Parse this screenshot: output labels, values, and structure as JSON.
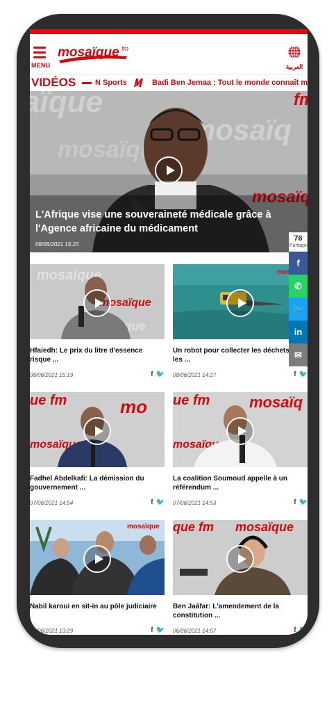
{
  "header": {
    "menu_label": "MENU",
    "logo_text": "mosaïque",
    "logo_suffix": "fm",
    "lang_label": "العربية"
  },
  "ticker": {
    "section_title": "VIDÉOS",
    "item1": "N Sports",
    "item2": "Badi Ben Jemaa : Tout le monde connaît mon cl"
  },
  "hero": {
    "title": "L'Afrique vise une souveraineté médicale grâce à l'Agence africaine du médicament",
    "date": "08/06/2021 15:20"
  },
  "videos": [
    {
      "title": "Hfaiedh: Le prix du litre d'essence risque ...",
      "date": "08/06/2021 15:19"
    },
    {
      "title": "Un robot pour collecter les déchets dans les ...",
      "date": "08/06/2021 14:27"
    },
    {
      "title": "Fadhel Abdelkafi: La démission du gouvernement ...",
      "date": "07/06/2021 14:54"
    },
    {
      "title": "La coalition Soumoud appelle à un référendum ...",
      "date": "07/06/2021 14:53"
    },
    {
      "title": "Nabil karoui en sit-in au pôle judiciaire",
      "date": "07/06/2021 13:29"
    },
    {
      "title": "Ben Jaâfar: L'amendement de la constitution ...",
      "date": "06/06/2021 14:57"
    }
  ],
  "share": {
    "count": "76",
    "label": "Partages",
    "buttons": [
      {
        "icon": "facebook-icon",
        "glyph": "f",
        "color": "#3b5998"
      },
      {
        "icon": "whatsapp-icon",
        "glyph": "✆",
        "color": "#25d366"
      },
      {
        "icon": "twitter-icon",
        "glyph": "🐦",
        "color": "#1da1f2"
      },
      {
        "icon": "linkedin-icon",
        "glyph": "in",
        "color": "#0077b5"
      },
      {
        "icon": "email-icon",
        "glyph": "✉",
        "color": "#7d7d7d"
      }
    ]
  },
  "colors": {
    "brand_red": "#d10a10",
    "phone_frame": "#2d2d2d"
  }
}
